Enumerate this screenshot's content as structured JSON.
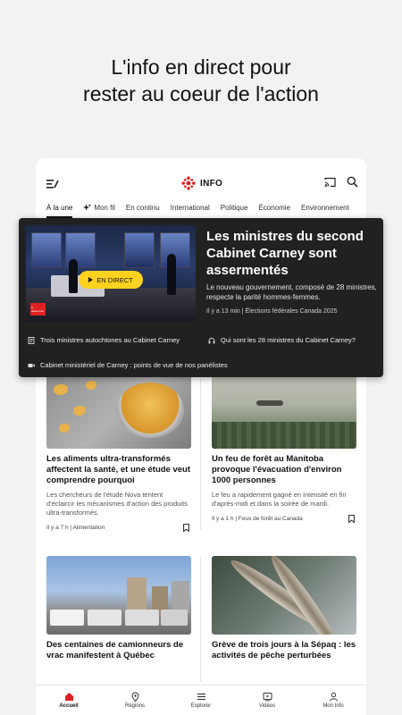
{
  "promo": {
    "line1": "L'info en direct pour",
    "line2": "rester au coeur de l'action"
  },
  "app": {
    "brand": "INFO",
    "accent": "#e02020"
  },
  "tabs": [
    {
      "label": "À la une",
      "active": true
    },
    {
      "label": "Mon fil",
      "icon": "sparkle-icon"
    },
    {
      "label": "En continu"
    },
    {
      "label": "International"
    },
    {
      "label": "Politique"
    },
    {
      "label": "Économie"
    },
    {
      "label": "Environnement"
    }
  ],
  "hero": {
    "live_label": "EN DIRECT",
    "badge": "le téléjournal",
    "title": "Les ministres du second Cabinet Carney sont assermentés",
    "summary": "Le nouveau gouvernement, composé de 28 ministres, respecte la parité hommes-femmes.",
    "meta": "Il y a 13 min | Élections fédérales Canada 2025",
    "related": [
      {
        "icon": "article-icon",
        "label": "Trois ministres autochtones au Cabinet Carney"
      },
      {
        "icon": "headphones-icon",
        "label": "Qui sont les 28 ministres du Cabinet Carney?"
      },
      {
        "icon": "video-icon",
        "label": "Cabinet ministériel de Carney : points de vue de nos panélistes"
      }
    ]
  },
  "cards": [
    {
      "title": "Les aliments ultra-transformés affectent la santé, et une étude veut comprendre pourquoi",
      "summary": "Les chercheurs de l'étude Nova tentent d'éclaircir les mécanismes d'action des produits ultra-transformés.",
      "meta": "Il y a 7 h | Alimentation"
    },
    {
      "title": "Un feu de forêt au Manitoba provoque l'évacuation d'environ 1000 personnes",
      "summary": "Le feu a rapidement gagné en intensité en fin d'après-midi et dans la soirée de mardi.",
      "meta": "Il y a 1 h | Feux de forêt au Canada"
    },
    {
      "title": "Des centaines de camionneurs de vrac manifestent à Québec",
      "summary": "",
      "meta": ""
    },
    {
      "title": "Grève de trois jours à la Sépaq : les activités de pêche perturbées",
      "summary": "",
      "meta": ""
    }
  ],
  "bottom_nav": [
    {
      "label": "Accueil",
      "icon": "home-icon",
      "active": true
    },
    {
      "label": "Régions",
      "icon": "location-pin-icon"
    },
    {
      "label": "Explorer",
      "icon": "list-icon"
    },
    {
      "label": "Vidéos",
      "icon": "play-box-icon"
    },
    {
      "label": "Mon Info",
      "icon": "person-icon"
    }
  ]
}
